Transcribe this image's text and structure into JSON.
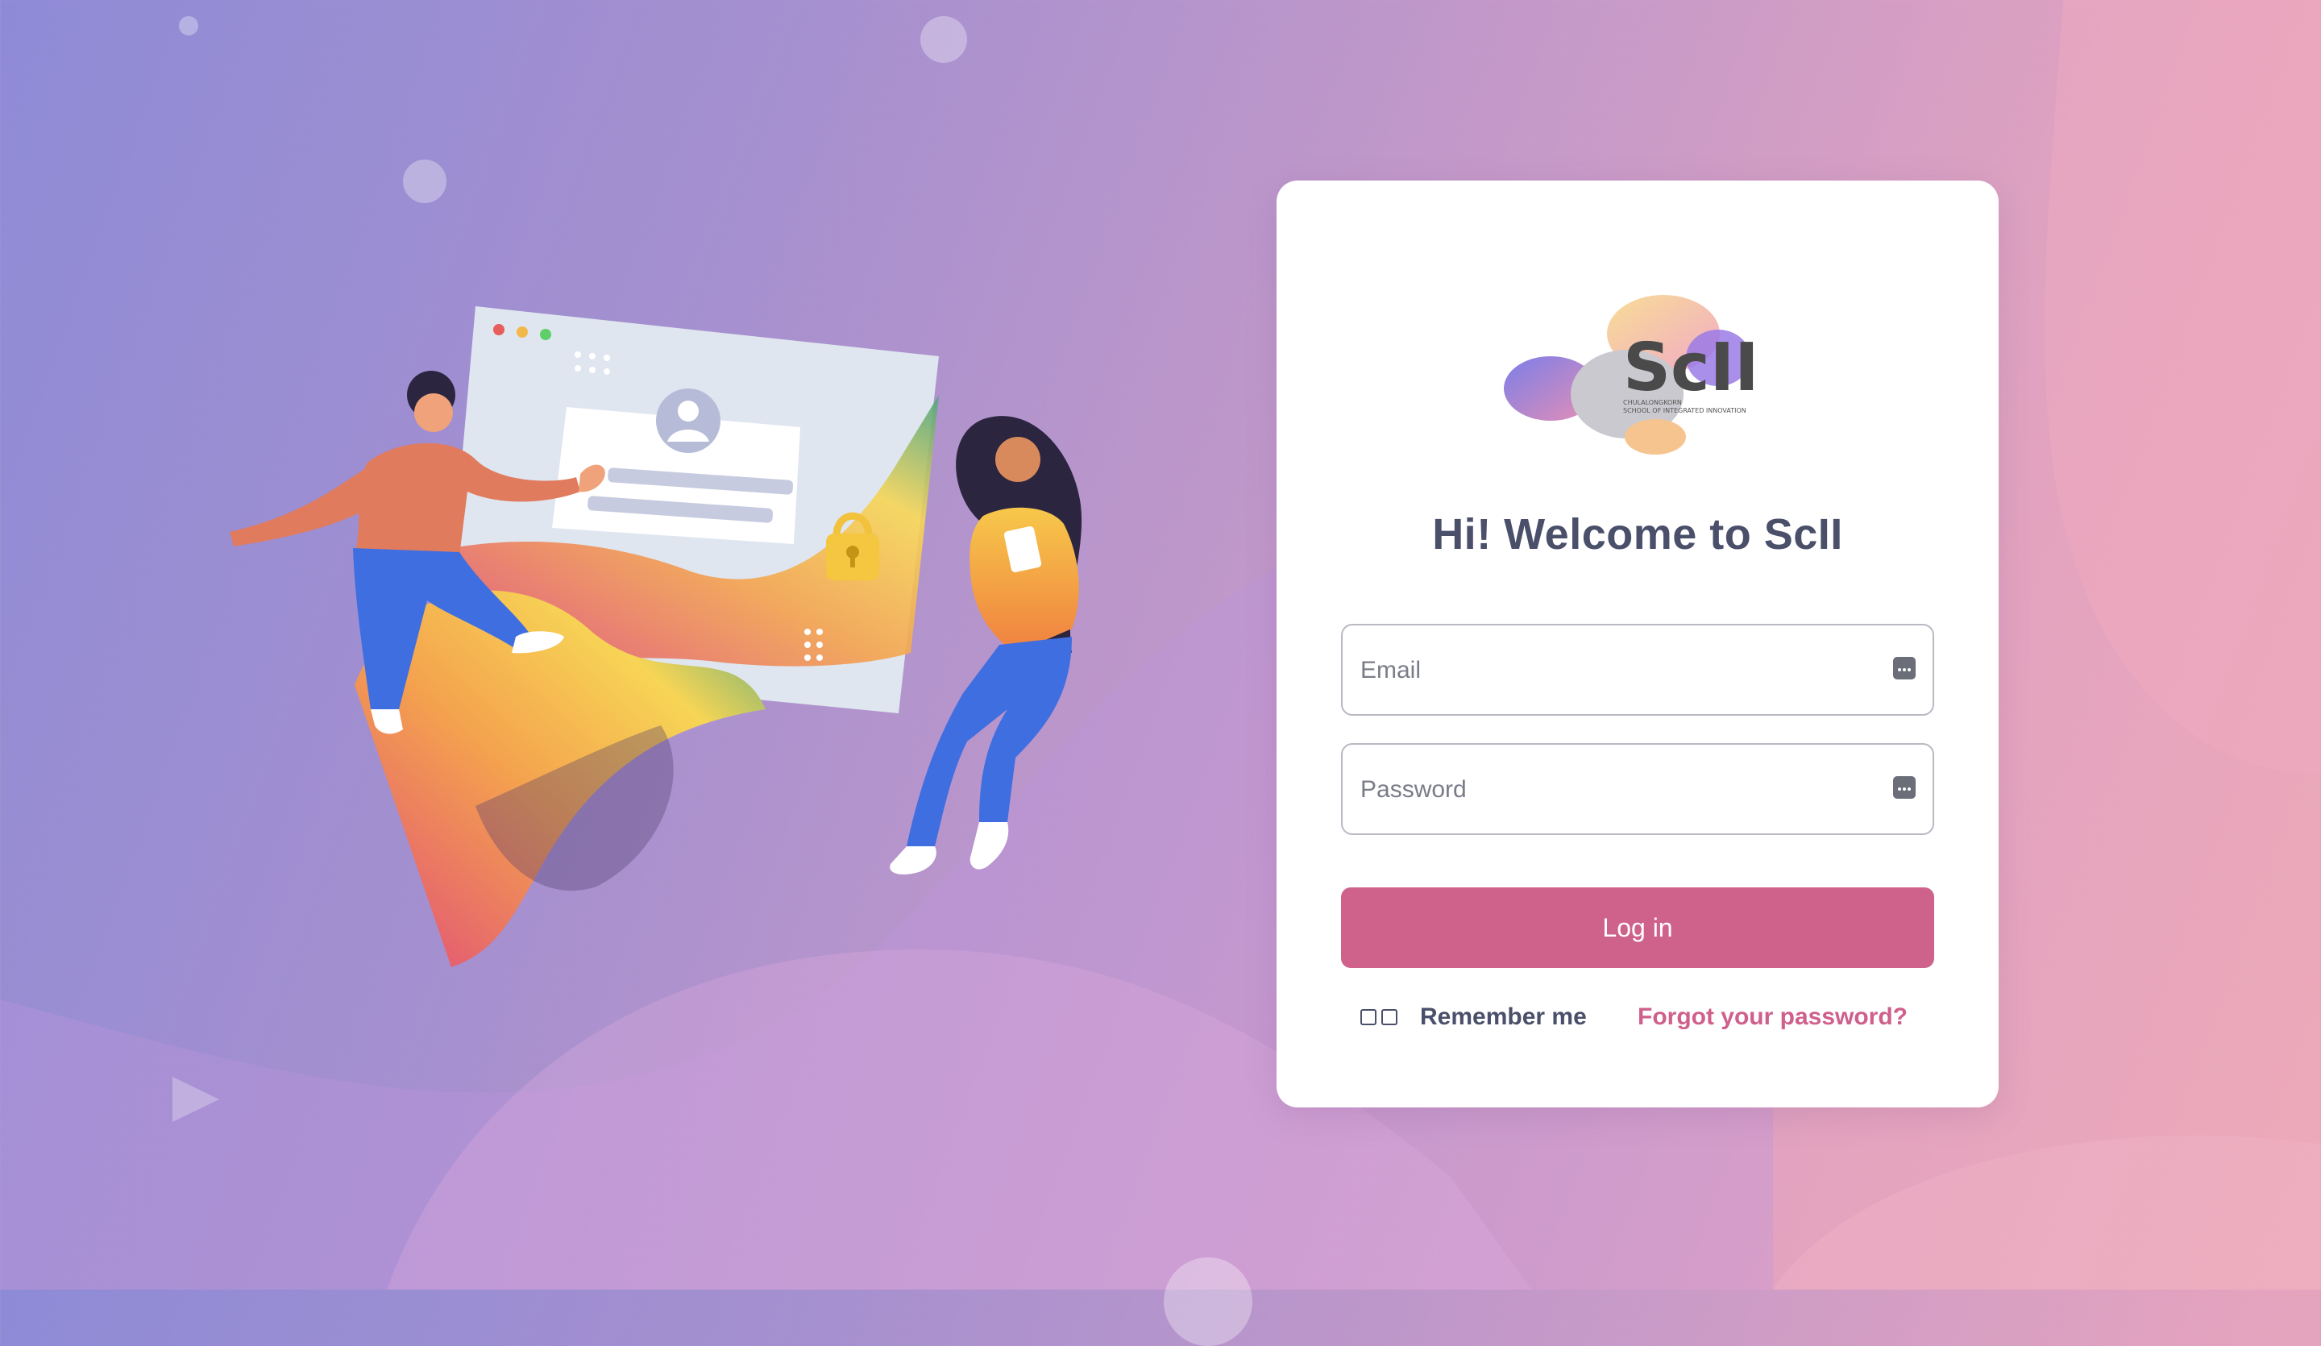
{
  "login": {
    "logo_text": "ScII",
    "logo_sub1": "CHULALONGKORN",
    "logo_sub2": "SCHOOL OF INTEGRATED INNOVATION",
    "title": "Hi! Welcome to ScII",
    "email_placeholder": "Email",
    "password_placeholder": "Password",
    "login_button": "Log in",
    "remember_label": "Remember me",
    "forgot_link": "Forgot your password?"
  },
  "icons": {
    "field_icon": "keyboard-icon",
    "play": "play-triangle-icon",
    "lock": "padlock-icon",
    "avatar": "user-avatar-icon"
  },
  "colors": {
    "accent": "#cf628a",
    "link": "#cf5f8b",
    "title": "#4a4f6a",
    "card": "#ffffff"
  }
}
